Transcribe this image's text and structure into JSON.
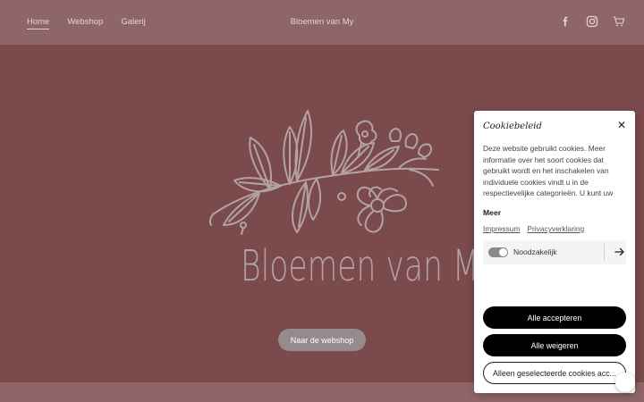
{
  "nav": {
    "items": [
      {
        "label": "Home",
        "active": true
      },
      {
        "label": "Webshop",
        "active": false
      },
      {
        "label": "Galerij",
        "active": false
      }
    ],
    "site_title": "Bloemen van My",
    "icons": [
      "facebook-icon",
      "instagram-icon",
      "cart-icon"
    ]
  },
  "hero": {
    "logo_text": "Bloemen van My",
    "cta_label": "Naar de webshop"
  },
  "cookie": {
    "title": "Cookiebeleid",
    "body": "Deze website gebruikt cookies. Meer informatie over het soort cookies dat gebruikt wordt en het inschakelen van individuele cookies vindt u in de respectievelijke categorieën. U kunt uw",
    "more_label": "Meer",
    "links": [
      "Impressum",
      "Privacyverklaring"
    ],
    "toggle_label": "Noodzakelijk",
    "accept_all": "Alle accepteren",
    "reject_all": "Alle weigeren",
    "accept_selected": "Alleen geselecteerde cookies acc..."
  },
  "colors": {
    "background": "#7b4a4c",
    "header": "#8f6667",
    "logo": "#b3a2a2",
    "button": "#958b8c"
  }
}
